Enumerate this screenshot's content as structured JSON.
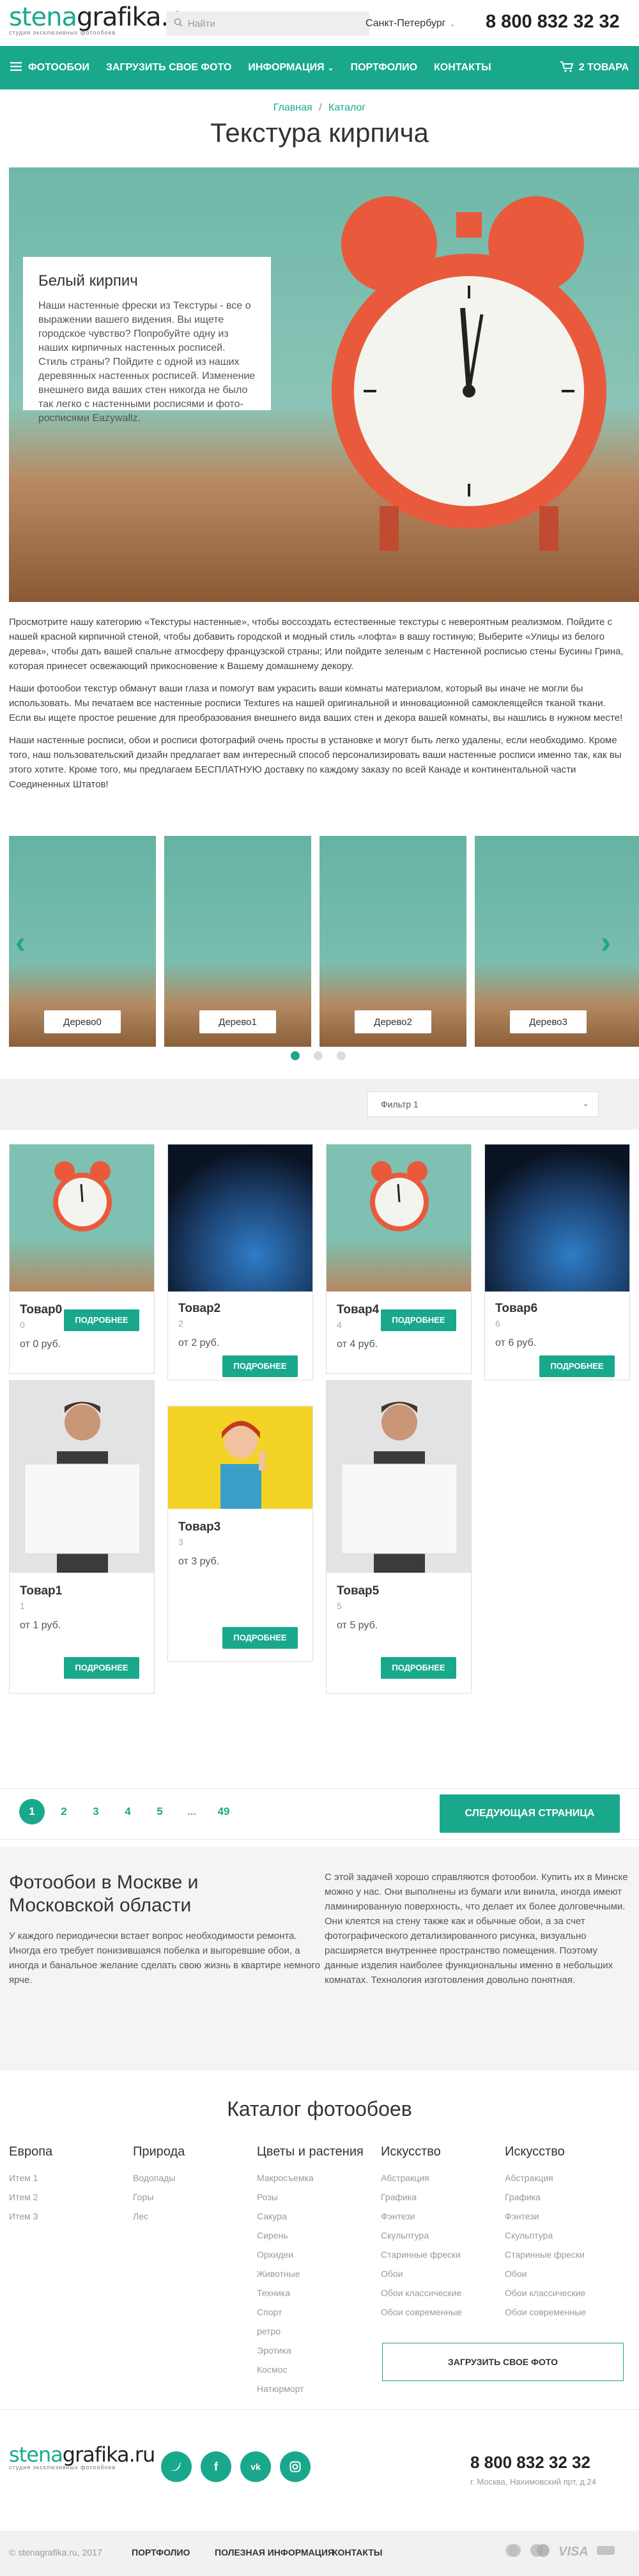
{
  "header": {
    "logo_text_color": "stena",
    "logo_text_dark": "grafika.ru",
    "logo_sub": "студия эксклюзивных фотообоев",
    "search_placeholder": "Найти",
    "city": "Санкт-Петербург",
    "phone": "8 800 832 32 32"
  },
  "nav": {
    "items": [
      "ФОТООБОИ",
      "ЗАГРУЗИТЬ СВОЕ ФОТО",
      "ИНФОРМАЦИЯ",
      "ПОРТФОЛИО",
      "КОНТАКТЫ"
    ],
    "cart": "2 ТОВАРА"
  },
  "breadcrumb": {
    "home": "Главная",
    "sep": "/",
    "catalog": "Каталог"
  },
  "title": "Текстура кирпича",
  "hero": {
    "card_title": "Белый кирпич",
    "card_text": "Наши настенные фрески из Текстуры - все о выражении вашего видения. Вы ищете городское чувство? Попробуйте одну из наших кирпичных настенных росписей. Стиль страны? Пойдите с одной из наших деревянных настенных росписей. Изменение внешнего вида ваших стен никогда не было так легко с настенными росписями и фото-росписями Eazywallz."
  },
  "paragraphs": [
    "Просмотрите нашу категорию «Текстуры настенные», чтобы воссоздать естественные текстуры с невероятным реализмом. Пойдите с нашей красной кирпичной стеной, чтобы добавить городской и модный стиль «лофта» в вашу гостиную; Выберите «Улицы из белого дерева», чтобы дать вашей спальне атмосферу французской страны; Или пойдите зеленым с Настенной росписью стены Бусины Грина, которая принесет освежающий прикосновение к Вашему домашнему декору.",
    "Наши фотообои текстур обманут ваши глаза и помогут вам украсить ваши комнаты материалом, который вы иначе не могли бы использовать. Мы печатаем все настенные росписи Textures на нашей оригинальной и инновационной самоклеящейся тканой ткани. Если вы ищете простое решение для преобразования внешнего вида ваших стен и декора вашей комнаты, вы нашлись в нужном месте!",
    "Наши настенные росписи, обои и росписи фотографий очень просты в установке и могут быть легко удалены, если необходимо. Кроме того, наш пользовательский дизайн предлагает вам интересный способ персонализировать ваши настенные росписи именно так, как вы этого хотите. Кроме того, мы предлагаем БЕСПЛАТНУЮ доставку по каждому заказу по всей Канаде и континентальной части Соединенных Штатов!"
  ],
  "carousel": {
    "labels": [
      "Дерево0",
      "Дерево1",
      "Дерево2",
      "Дерево3"
    ]
  },
  "filter": {
    "value": "Фильтр 1"
  },
  "products": {
    "more": "ПОДРОБНЕЕ",
    "items": [
      {
        "title": "Товар0",
        "num": "0",
        "price": "от 0 руб."
      },
      {
        "title": "Товар1",
        "num": "1",
        "price": "от 1 руб."
      },
      {
        "title": "Товар2",
        "num": "2",
        "price": "от 2 руб."
      },
      {
        "title": "Товар3",
        "num": "3",
        "price": "от 3 руб."
      },
      {
        "title": "Товар4",
        "num": "4",
        "price": "от 4 руб."
      },
      {
        "title": "Товар5",
        "num": "5",
        "price": "от 5 руб."
      },
      {
        "title": "Товар6",
        "num": "6",
        "price": "от 6 руб."
      }
    ]
  },
  "pagination": {
    "pages": [
      "1",
      "2",
      "3",
      "4",
      "5",
      "...",
      "49"
    ],
    "next": "СЛЕДУЮЩАЯ СТРАНИЦА"
  },
  "seo": {
    "title": "Фотообои в Москве и Московской области",
    "left": "У каждого периодически встает вопрос необходимости ремонта. Иногда его требует понизившаяся побелка и выгоревшие обои, а иногда и банальное желание сделать свою жизнь в квартире немного ярче.",
    "right": "С этой задачей хорошо справляются фотообои. Купить их в Минске можно у нас. Они выполнены из бумаги или винила, иногда имеют ламинированную поверхность, что делает их более долговечными. Они клеятся на стену также как и обычные обои, а за счет фотографического детализированного рисунка, визуально расширяется внутреннее пространство помещения. Поэтому данные изделия наиболее функциональны именно в небольших комнатах. Технология изготовления довольно понятная."
  },
  "catalog": {
    "title": "Каталог фотообоев",
    "columns": [
      {
        "head": "Европа",
        "items": [
          "Итем 1",
          "Итем 2",
          "Итем 3"
        ]
      },
      {
        "head": "Природа",
        "items": [
          "Водопады",
          "Горы",
          "Лес"
        ]
      },
      {
        "head": "Цветы и растения",
        "items": [
          "Макросъемка",
          "Розы",
          "Сакура",
          "Сирень",
          "Орхидеи",
          "Животные",
          "Техника",
          "Спорт",
          "ретро",
          "Эротика",
          "Космос",
          "Натюрморт"
        ]
      },
      {
        "head": "Искусство",
        "items": [
          "Абстракция",
          "Графика",
          "Фэнтези",
          "Скульптура",
          "Старинные фрески",
          "Обои",
          "Обои классические",
          "Обои современные"
        ]
      },
      {
        "head": "Искусство",
        "items": [
          "Абстракция",
          "Графика",
          "Фэнтези",
          "Скульптура",
          "Старинные фрески",
          "Обои",
          "Обои классические",
          "Обои современные"
        ]
      }
    ],
    "upload": "ЗАГРУЗИТЬ СВОЕ ФОТО"
  },
  "footer": {
    "phone": "8 800 832 32 32",
    "address": "г. Москва, Нахимовский прт, д.24",
    "copyright": "© stenagrafika.ru, 2017",
    "links": [
      "ПОРТФОЛИО",
      "ПОЛЕЗНАЯ ИНФОРМАЦИЯ",
      "КОНТАКТЫ"
    ],
    "social": [
      "tw",
      "f",
      "vk",
      "ig"
    ],
    "pay": [
      "VISA"
    ]
  },
  "colors": {
    "accent": "#1aa88c"
  }
}
